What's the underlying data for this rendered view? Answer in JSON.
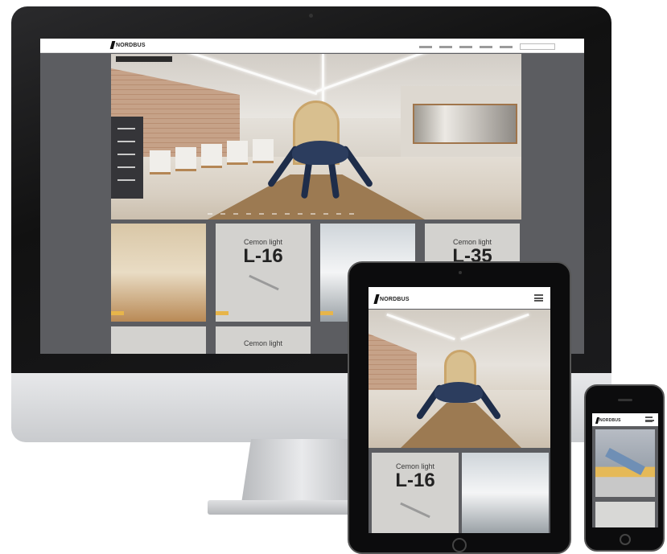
{
  "site": {
    "logo_text": "NORDBUS"
  },
  "desktop": {
    "nav_items": [
      "",
      "",
      "",
      "",
      "",
      ""
    ],
    "tiles": [
      {
        "type": "room"
      },
      {
        "type": "light",
        "title": "Cemon light",
        "code": "L-16"
      },
      {
        "type": "white"
      },
      {
        "type": "light",
        "title": "Cemon light",
        "code": "L-35"
      }
    ]
  },
  "tablet": {
    "tile": {
      "title": "Cemon light",
      "code": "L-16"
    }
  },
  "icons": [
    "menu-icon",
    "search-icon",
    "logo-mark"
  ]
}
